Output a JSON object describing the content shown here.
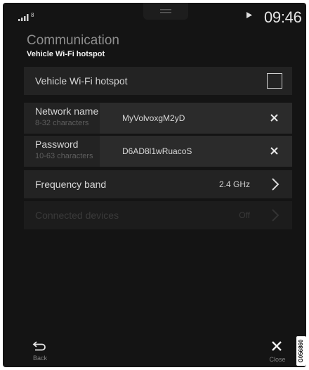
{
  "status_bar": {
    "signal_icon": "signal-bars-icon",
    "badge": "8",
    "handle_icon": "drag-handle-icon",
    "media_icon": "play-icon",
    "time": "09:46"
  },
  "header": {
    "category": "Communication",
    "title": "Vehicle Wi-Fi hotspot"
  },
  "settings": {
    "hotspot": {
      "label": "Vehicle Wi-Fi hotspot",
      "checked": false
    },
    "network_name": {
      "label": "Network name",
      "hint": "8-32 characters",
      "value": "MyVolvoxgM2yD"
    },
    "password": {
      "label": "Password",
      "hint": "10-63 characters",
      "value": "D6AD8l1wRuacoS"
    },
    "frequency_band": {
      "label": "Frequency band",
      "value": "2.4 GHz"
    },
    "connected_devices": {
      "label": "Connected devices",
      "value": "Off"
    }
  },
  "footer": {
    "back_label": "Back",
    "close_label": "Close",
    "side_code": "G056860"
  },
  "colors": {
    "screen_background": "#141414",
    "row_background": "#232323",
    "field_background": "#2b2b2b",
    "primary_text": "#d6d6d6",
    "secondary_text": "#5e5e5e"
  }
}
